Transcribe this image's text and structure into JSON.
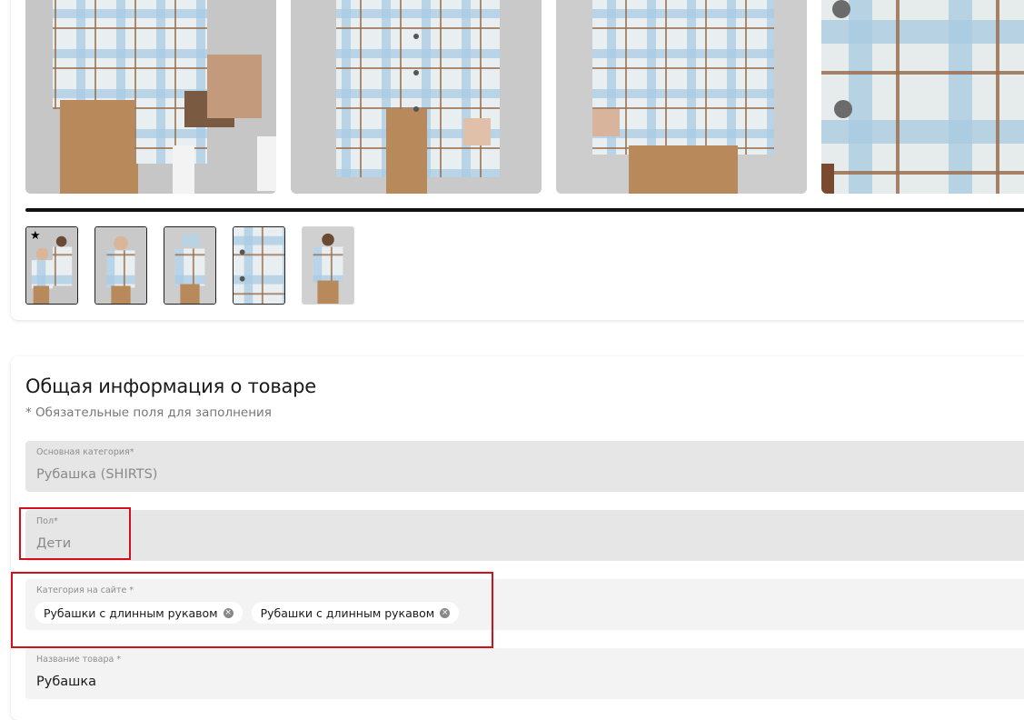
{
  "gallery": {
    "photos": [
      {
        "icon": "product-photo-two-kids"
      },
      {
        "icon": "product-photo-front"
      },
      {
        "icon": "product-photo-back"
      },
      {
        "icon": "product-photo-detail"
      }
    ],
    "thumbnails": [
      {
        "icon": "thumbnail-two-kids",
        "main_marker": "★"
      },
      {
        "icon": "thumbnail-front"
      },
      {
        "icon": "thumbnail-back"
      },
      {
        "icon": "thumbnail-detail"
      },
      {
        "icon": "thumbnail-full"
      }
    ]
  },
  "info": {
    "title": "Общая информация о товаре",
    "required_note": "* Обязательные поля для заполнения",
    "main_category": {
      "label": "Основная категория*",
      "value": "Рубашка (SHIRTS)"
    },
    "gender": {
      "label": "Пол*",
      "value": "Дети"
    },
    "site_category": {
      "label": "Категория на сайте *",
      "chips": [
        "Рубашки с длинным рукавом",
        "Рубашки с длинным рукавом"
      ],
      "remove_glyph": "×"
    },
    "product_name": {
      "label": "Название товара *",
      "value": "Рубашка"
    }
  },
  "colors": {
    "highlight": "#d0101a",
    "plaid_base": "#e9eef0",
    "plaid_blue": "#9cc3dd",
    "plaid_brown": "#9a7050",
    "corduroy": "#b8895a",
    "background_gray": "#c9c9c9"
  }
}
